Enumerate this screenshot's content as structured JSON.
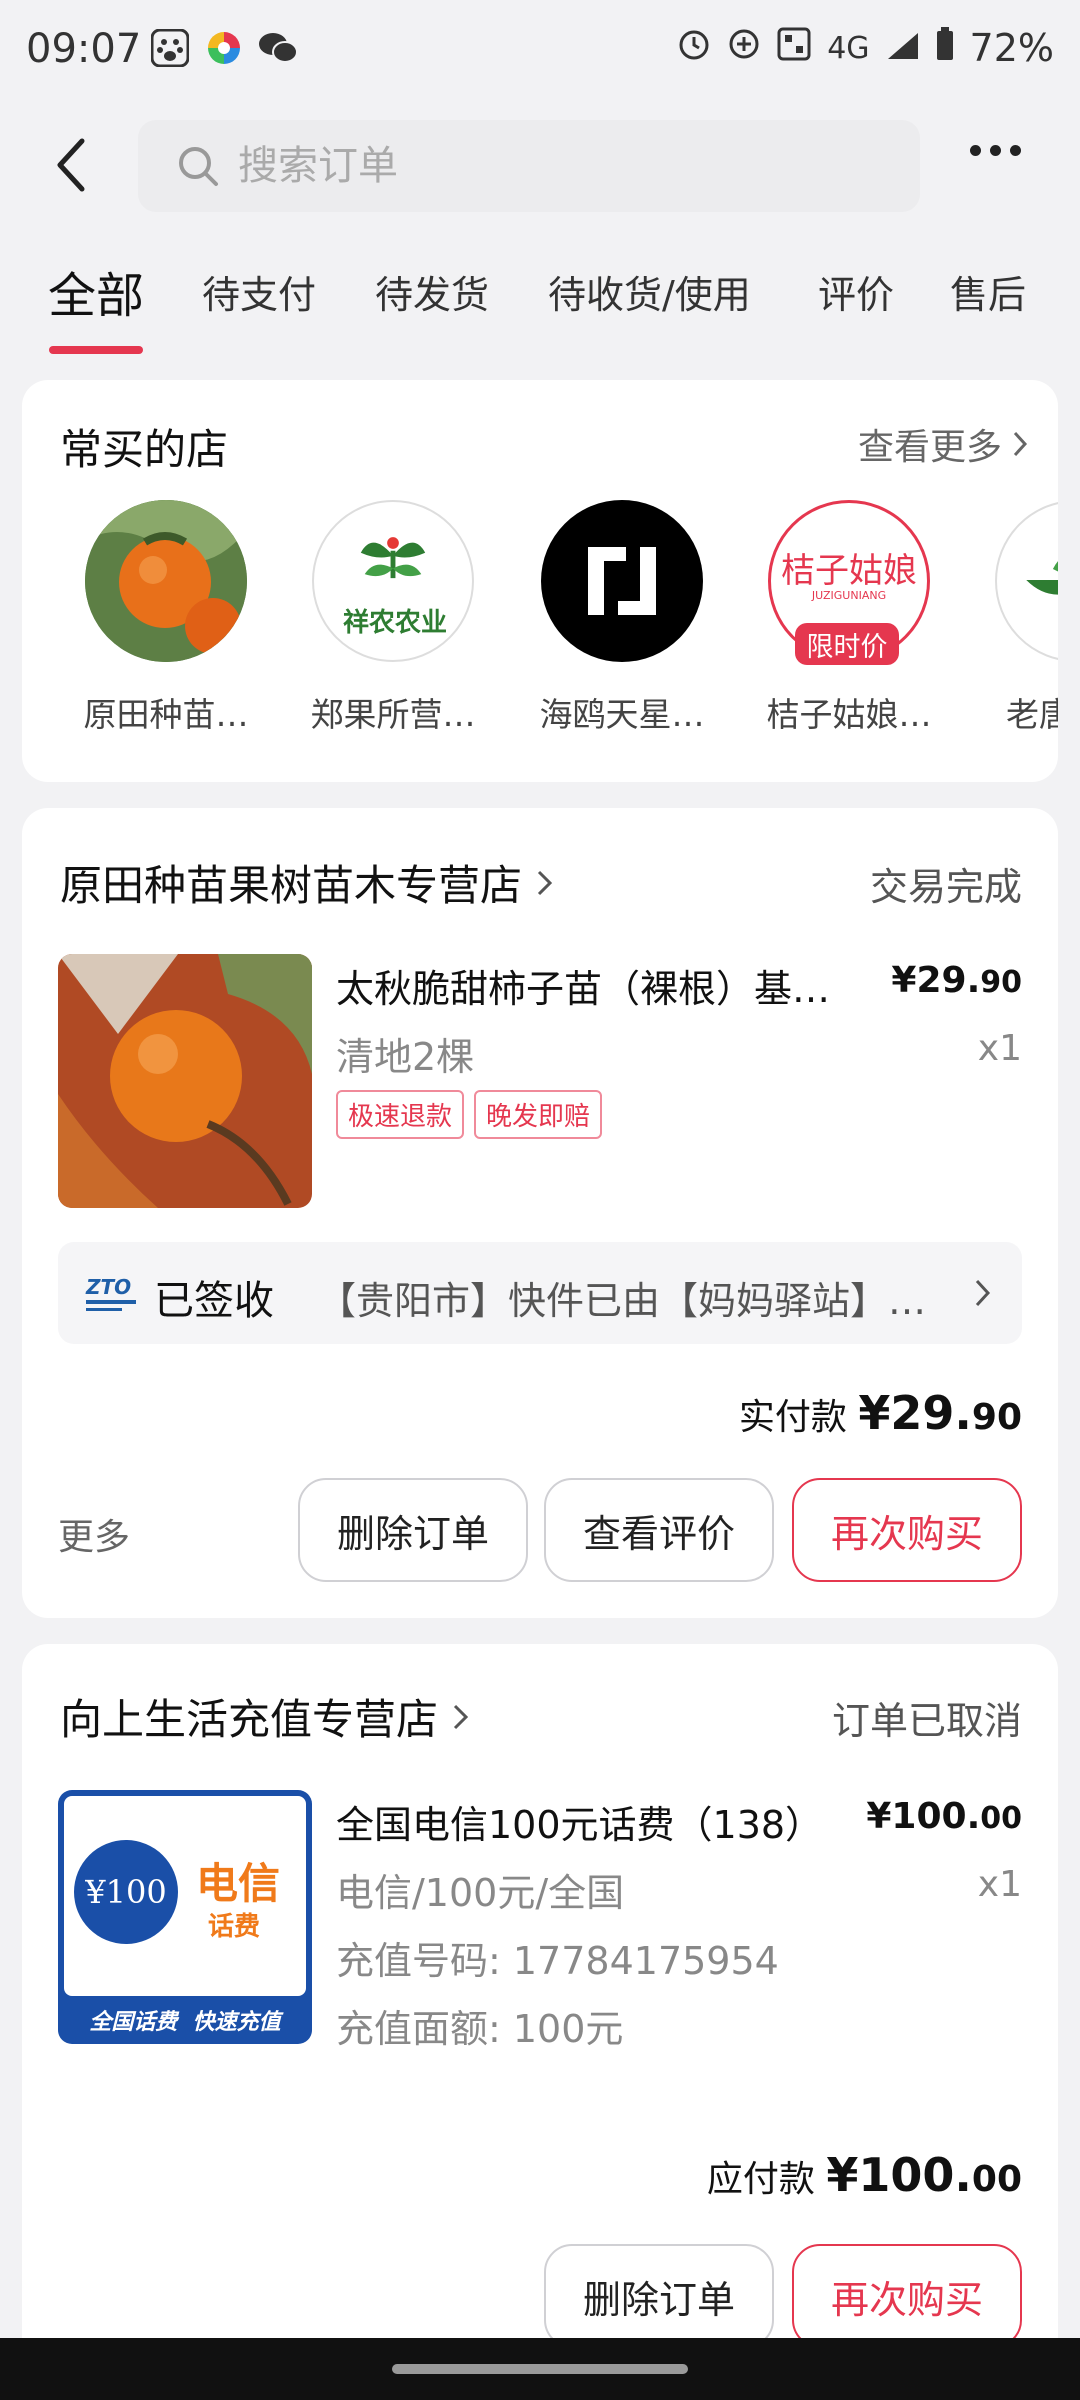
{
  "status_bar": {
    "time": "09:07",
    "network": "4G",
    "battery": "72%",
    "left_icons": [
      "baidu-icon",
      "app-icon",
      "wechat-icon"
    ],
    "right_icons": [
      "alarm-icon",
      "sync-icon",
      "nfc-icon",
      "signal-icon",
      "battery-icon"
    ]
  },
  "search": {
    "placeholder": "搜索订单"
  },
  "tabs": [
    {
      "label": "全部",
      "active": true
    },
    {
      "label": "待支付"
    },
    {
      "label": "待发货"
    },
    {
      "label": "待收货/使用"
    },
    {
      "label": "评价"
    },
    {
      "label": "售后"
    }
  ],
  "frequent_shops": {
    "title": "常买的店",
    "view_more": "查看更多",
    "shops": [
      {
        "name": "原田种苗…"
      },
      {
        "name": "郑果所营…",
        "logo_text": "祥农农业"
      },
      {
        "name": "海鸥天星…"
      },
      {
        "name": "桔子姑娘…",
        "logo_text": "桔子姑娘",
        "logo_sub": "JUZIGUNIANG",
        "badge": "限时价"
      },
      {
        "name": "老唐"
      }
    ]
  },
  "orders": [
    {
      "shop": "原田种苗果树苗木专营店",
      "status": "交易完成",
      "product_title": "太秋脆甜柿子苗（裸根）基…",
      "product_spec": "清地2棵",
      "price_int": "¥29.",
      "price_dec": "90",
      "quantity": "x1",
      "tags": [
        "极速退款",
        "晚发即赔"
      ],
      "logistics": {
        "status": "已签收",
        "message": "【贵阳市】快件已由【妈妈驿站】…",
        "carrier_logo": "ZTO"
      },
      "paid_label": "实付款",
      "paid_int": "¥29.",
      "paid_dec": "90",
      "more": "更多",
      "buttons": [
        "删除订单",
        "查看评价",
        "再次购买"
      ]
    },
    {
      "shop": "向上生活充值专营店",
      "status": "订单已取消",
      "product_title": "全国电信100元话费（138）",
      "product_spec": "电信/100元/全国",
      "phone": "充值号码: 17784175954",
      "face_value": "充值面额: 100元",
      "price_int": "¥100.",
      "price_dec": "00",
      "quantity": "x1",
      "thumb": {
        "amount": "¥100",
        "brand": "电信",
        "sub": "话费",
        "banner": "全国话费  快速充值"
      },
      "paid_label": "应付款",
      "paid_int": "¥100.",
      "paid_dec": "00",
      "buttons": [
        "删除订单",
        "再次购买"
      ]
    }
  ],
  "colors": {
    "accent": "#e5374f",
    "background": "#f2f2f4"
  }
}
